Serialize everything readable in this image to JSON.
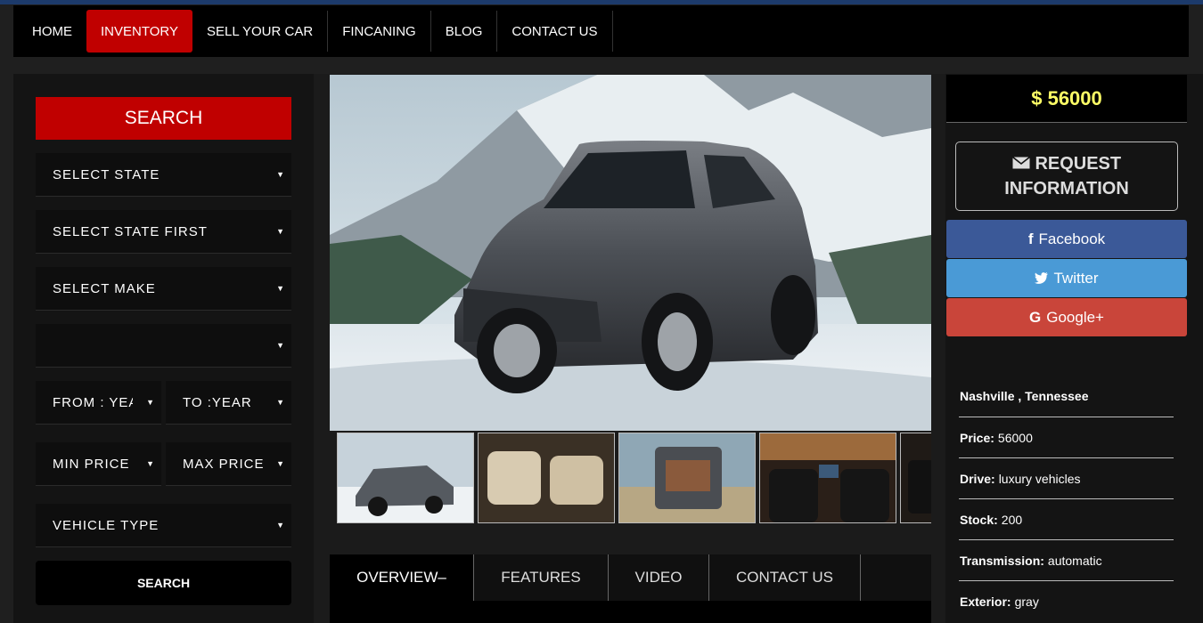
{
  "nav": {
    "items": [
      "HOME",
      "INVENTORY",
      "SELL YOUR CAR",
      "FINCANING",
      "BLOG",
      "CONTACT US"
    ]
  },
  "search": {
    "heading": "SEARCH",
    "state": "SELECT STATE",
    "city": "SELECT STATE FIRST",
    "make": "SELECT MAKE",
    "model": "",
    "from_year": "FROM : YEAR",
    "to_year": "TO :YEAR",
    "min_price": "MIN PRICE",
    "max_price": "MAX PRICE",
    "vehicle_type": "VEHICLE TYPE",
    "button": "SEARCH"
  },
  "tabs": [
    "OVERVIEW–",
    "FEATURES",
    "VIDEO",
    "CONTACT US"
  ],
  "sidebar": {
    "price": "$ 56000",
    "request_line1": "REQUEST",
    "request_line2": "INFORMATION",
    "facebook": "Facebook",
    "twitter": "Twitter",
    "google": "Google+",
    "location": "Nashville , Tennessee",
    "details": [
      {
        "label": "Price:",
        "value": "56000"
      },
      {
        "label": "Drive:",
        "value": "luxury vehicles"
      },
      {
        "label": "Stock:",
        "value": "200"
      },
      {
        "label": "Transmission:",
        "value": "automatic"
      },
      {
        "label": "Exterior:",
        "value": "gray"
      }
    ]
  },
  "colors": {
    "accent": "#c00000",
    "price": "#ffff66",
    "facebook": "#3b5998",
    "twitter": "#4a9ad6",
    "google": "#c9453a"
  },
  "icons": {
    "request": "envelope-icon",
    "facebook": "facebook-icon",
    "twitter": "twitter-icon",
    "google": "google-icon",
    "select": "dropdown-arrow-icon"
  }
}
